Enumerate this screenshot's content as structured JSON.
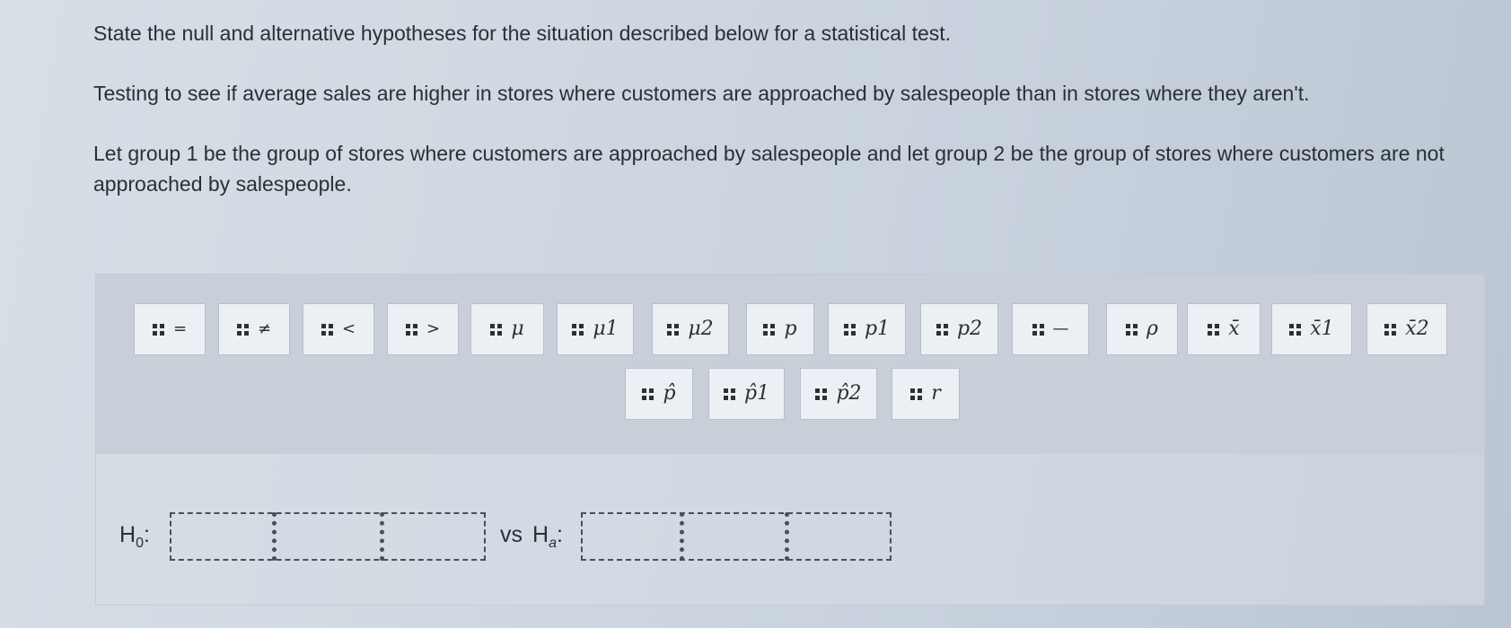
{
  "question": {
    "line1": "State the null and alternative hypotheses for the situation described below for a statistical test.",
    "line2": "Testing to see if average sales are higher in stores where customers are approached by salespeople than in stores where they aren't.",
    "line3": "Let group 1 be the group of stores where customers are approached by salespeople and let group 2 be the group of stores where customers are not approached by salespeople."
  },
  "palette": {
    "row1": [
      "=",
      "≠",
      "<",
      ">",
      "μ",
      "μ1",
      "μ2",
      "p",
      "p1",
      "p2",
      "—",
      "ρ",
      "x̄",
      "x̄1",
      "x̄2"
    ],
    "row2": [
      "p̂",
      "p̂1",
      "p̂2",
      "r"
    ]
  },
  "hypotheses": {
    "h0_label": "H",
    "h0_sub": "0",
    "ha_label": "H",
    "ha_sub": "a",
    "vs_label": "vs",
    "colon": ":"
  }
}
